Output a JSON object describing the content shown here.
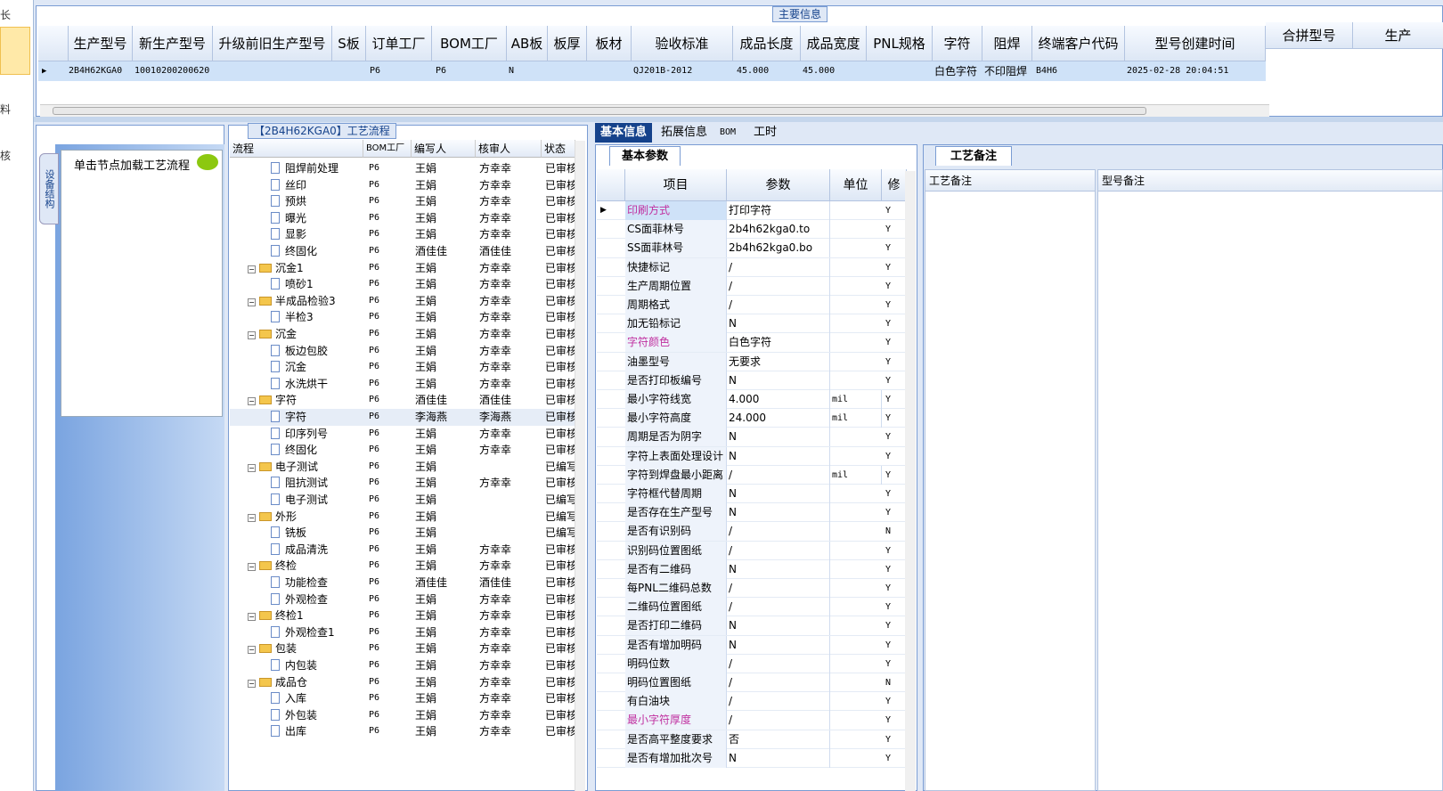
{
  "left_strip": {
    "items": [
      "长",
      "料",
      "核"
    ]
  },
  "top": {
    "legend": "主要信息",
    "headers": [
      "生产型号",
      "新生产型号",
      "升级前旧生产型号",
      "S板",
      "订单工厂",
      "BOM工厂",
      "AB板",
      "板厚",
      "板材",
      "验收标准",
      "成品长度",
      "成品宽度",
      "PNL规格",
      "字符",
      "阻焊",
      "终端客户代码",
      "型号创建时间",
      "合拼型号",
      "生产"
    ],
    "row": {
      "c1": "2B4H62KGA0",
      "c2": "10010200200620",
      "c3": "P6",
      "c4": "P6",
      "c5": "N",
      "c6": "QJ201B-2012",
      "c7": "45.000",
      "c8": "45.000",
      "c9": "白色字符",
      "c10": "不印阻焊",
      "c11": "B4H6",
      "c12": "2025-02-28 20:04:51"
    }
  },
  "left_panel": {
    "tab": "设备结构",
    "hint": "单击节点加载工艺流程"
  },
  "tree": {
    "title": "【2B4H62KGA0】工艺流程",
    "headers": [
      "流程",
      "BOM工厂",
      "编写人",
      "核审人",
      "状态"
    ],
    "rows": [
      {
        "n": "阻焊前处理",
        "t": "d",
        "l": 2,
        "f": "P6",
        "w": "王娟",
        "r": "方幸幸",
        "s": "已审核"
      },
      {
        "n": "丝印",
        "t": "d",
        "l": 2,
        "f": "P6",
        "w": "王娟",
        "r": "方幸幸",
        "s": "已审核"
      },
      {
        "n": "预烘",
        "t": "d",
        "l": 2,
        "f": "P6",
        "w": "王娟",
        "r": "方幸幸",
        "s": "已审核"
      },
      {
        "n": "曝光",
        "t": "d",
        "l": 2,
        "f": "P6",
        "w": "王娟",
        "r": "方幸幸",
        "s": "已审核"
      },
      {
        "n": "显影",
        "t": "d",
        "l": 2,
        "f": "P6",
        "w": "王娟",
        "r": "方幸幸",
        "s": "已审核"
      },
      {
        "n": "终固化",
        "t": "d",
        "l": 2,
        "f": "P6",
        "w": "酒佳佳",
        "r": "酒佳佳",
        "s": "已审核"
      },
      {
        "n": "沉金1",
        "t": "f",
        "l": 1,
        "f": "P6",
        "w": "王娟",
        "r": "方幸幸",
        "s": "已审核"
      },
      {
        "n": "喷砂1",
        "t": "d",
        "l": 2,
        "f": "P6",
        "w": "王娟",
        "r": "方幸幸",
        "s": "已审核"
      },
      {
        "n": "半成品检验3",
        "t": "f",
        "l": 1,
        "f": "P6",
        "w": "王娟",
        "r": "方幸幸",
        "s": "已审核"
      },
      {
        "n": "半检3",
        "t": "d",
        "l": 2,
        "f": "P6",
        "w": "王娟",
        "r": "方幸幸",
        "s": "已审核"
      },
      {
        "n": "沉金",
        "t": "f",
        "l": 1,
        "f": "P6",
        "w": "王娟",
        "r": "方幸幸",
        "s": "已审核"
      },
      {
        "n": "板边包胶",
        "t": "d",
        "l": 2,
        "f": "P6",
        "w": "王娟",
        "r": "方幸幸",
        "s": "已审核"
      },
      {
        "n": "沉金",
        "t": "d",
        "l": 2,
        "f": "P6",
        "w": "王娟",
        "r": "方幸幸",
        "s": "已审核"
      },
      {
        "n": "水洗烘干",
        "t": "d",
        "l": 2,
        "f": "P6",
        "w": "王娟",
        "r": "方幸幸",
        "s": "已审核"
      },
      {
        "n": "字符",
        "t": "f",
        "l": 1,
        "f": "P6",
        "w": "酒佳佳",
        "r": "酒佳佳",
        "s": "已审核"
      },
      {
        "n": "字符",
        "t": "d",
        "l": 2,
        "f": "P6",
        "w": "李海燕",
        "r": "李海燕",
        "s": "已审核"
      },
      {
        "n": "印序列号",
        "t": "d",
        "l": 2,
        "f": "P6",
        "w": "王娟",
        "r": "方幸幸",
        "s": "已审核"
      },
      {
        "n": "终固化",
        "t": "d",
        "l": 2,
        "f": "P6",
        "w": "王娟",
        "r": "方幸幸",
        "s": "已审核"
      },
      {
        "n": "电子测试",
        "t": "f",
        "l": 1,
        "f": "P6",
        "w": "王娟",
        "r": "",
        "s": "已编写"
      },
      {
        "n": "阻抗测试",
        "t": "d",
        "l": 2,
        "f": "P6",
        "w": "王娟",
        "r": "方幸幸",
        "s": "已审核"
      },
      {
        "n": "电子测试",
        "t": "d",
        "l": 2,
        "f": "P6",
        "w": "王娟",
        "r": "",
        "s": "已编写"
      },
      {
        "n": "外形",
        "t": "f",
        "l": 1,
        "f": "P6",
        "w": "王娟",
        "r": "",
        "s": "已编写"
      },
      {
        "n": "铣板",
        "t": "d",
        "l": 2,
        "f": "P6",
        "w": "王娟",
        "r": "",
        "s": "已编写"
      },
      {
        "n": "成品清洗",
        "t": "d",
        "l": 2,
        "f": "P6",
        "w": "王娟",
        "r": "方幸幸",
        "s": "已审核"
      },
      {
        "n": "终检",
        "t": "f",
        "l": 1,
        "f": "P6",
        "w": "王娟",
        "r": "方幸幸",
        "s": "已审核"
      },
      {
        "n": "功能检查",
        "t": "d",
        "l": 2,
        "f": "P6",
        "w": "酒佳佳",
        "r": "酒佳佳",
        "s": "已审核"
      },
      {
        "n": "外观检查",
        "t": "d",
        "l": 2,
        "f": "P6",
        "w": "王娟",
        "r": "方幸幸",
        "s": "已审核"
      },
      {
        "n": "终检1",
        "t": "f",
        "l": 1,
        "f": "P6",
        "w": "王娟",
        "r": "方幸幸",
        "s": "已审核"
      },
      {
        "n": "外观检查1",
        "t": "d",
        "l": 2,
        "f": "P6",
        "w": "王娟",
        "r": "方幸幸",
        "s": "已审核"
      },
      {
        "n": "包装",
        "t": "f",
        "l": 1,
        "f": "P6",
        "w": "王娟",
        "r": "方幸幸",
        "s": "已审核"
      },
      {
        "n": "内包装",
        "t": "d",
        "l": 2,
        "f": "P6",
        "w": "王娟",
        "r": "方幸幸",
        "s": "已审核"
      },
      {
        "n": "成品仓",
        "t": "f",
        "l": 1,
        "f": "P6",
        "w": "王娟",
        "r": "方幸幸",
        "s": "已审核"
      },
      {
        "n": "入库",
        "t": "d",
        "l": 2,
        "f": "P6",
        "w": "王娟",
        "r": "方幸幸",
        "s": "已审核"
      },
      {
        "n": "外包装",
        "t": "d",
        "l": 2,
        "f": "P6",
        "w": "王娟",
        "r": "方幸幸",
        "s": "已审核"
      },
      {
        "n": "出库",
        "t": "d",
        "l": 2,
        "f": "P6",
        "w": "王娟",
        "r": "方幸幸",
        "s": "已审核"
      }
    ]
  },
  "right_tabs": [
    "基本信息",
    "拓展信息",
    "BOM",
    "工时"
  ],
  "params": {
    "tab": "基本参数",
    "headers": [
      "项目",
      "参数",
      "单位",
      "修"
    ],
    "rows": [
      {
        "k": "印刷方式",
        "v": "打印字符",
        "u": "",
        "m": "Y",
        "pink": true,
        "sel": true
      },
      {
        "k": "CS面菲林号",
        "v": "2b4h62kga0.to",
        "u": "",
        "m": "Y"
      },
      {
        "k": "SS面菲林号",
        "v": "2b4h62kga0.bo",
        "u": "",
        "m": "Y"
      },
      {
        "k": "快捷标记",
        "v": "/",
        "u": "",
        "m": "Y"
      },
      {
        "k": "生产周期位置",
        "v": "/",
        "u": "",
        "m": "Y"
      },
      {
        "k": "周期格式",
        "v": "/",
        "u": "",
        "m": "Y"
      },
      {
        "k": "加无铅标记",
        "v": "N",
        "u": "",
        "m": "Y"
      },
      {
        "k": "字符颜色",
        "v": "白色字符",
        "u": "",
        "m": "Y",
        "pink": true
      },
      {
        "k": "油墨型号",
        "v": "无要求",
        "u": "",
        "m": "Y"
      },
      {
        "k": "是否打印板编号",
        "v": "N",
        "u": "",
        "m": "Y"
      },
      {
        "k": "最小字符线宽",
        "v": "4.000",
        "u": "mil",
        "m": "Y"
      },
      {
        "k": "最小字符高度",
        "v": "24.000",
        "u": "mil",
        "m": "Y"
      },
      {
        "k": "周期是否为阴字",
        "v": "N",
        "u": "",
        "m": "Y"
      },
      {
        "k": "字符上表面处理设计",
        "v": "N",
        "u": "",
        "m": "Y"
      },
      {
        "k": "字符到焊盘最小距离",
        "v": "/",
        "u": "mil",
        "m": "Y"
      },
      {
        "k": "字符框代替周期",
        "v": "N",
        "u": "",
        "m": "Y"
      },
      {
        "k": "是否存在生产型号",
        "v": "N",
        "u": "",
        "m": "Y"
      },
      {
        "k": "是否有识别码",
        "v": "/",
        "u": "",
        "m": "N"
      },
      {
        "k": "识别码位置图纸",
        "v": "/",
        "u": "",
        "m": "Y"
      },
      {
        "k": "是否有二维码",
        "v": "N",
        "u": "",
        "m": "Y"
      },
      {
        "k": "每PNL二维码总数",
        "v": "/",
        "u": "",
        "m": "Y"
      },
      {
        "k": "二维码位置图纸",
        "v": "/",
        "u": "",
        "m": "Y"
      },
      {
        "k": "是否打印二维码",
        "v": "N",
        "u": "",
        "m": "Y"
      },
      {
        "k": "是否有增加明码",
        "v": "N",
        "u": "",
        "m": "Y"
      },
      {
        "k": "明码位数",
        "v": "/",
        "u": "",
        "m": "Y"
      },
      {
        "k": "明码位置图纸",
        "v": "/",
        "u": "",
        "m": "N"
      },
      {
        "k": "有白油块",
        "v": "/",
        "u": "",
        "m": "Y"
      },
      {
        "k": "最小字符厚度",
        "v": "/",
        "u": "",
        "m": "Y",
        "pink": true
      },
      {
        "k": "是否高平整度要求",
        "v": "否",
        "u": "",
        "m": "Y"
      },
      {
        "k": "是否有增加批次号",
        "v": "N",
        "u": "",
        "m": "Y"
      }
    ]
  },
  "notes": {
    "tab": "工艺备注",
    "col1": "工艺备注",
    "col2": "型号备注"
  }
}
